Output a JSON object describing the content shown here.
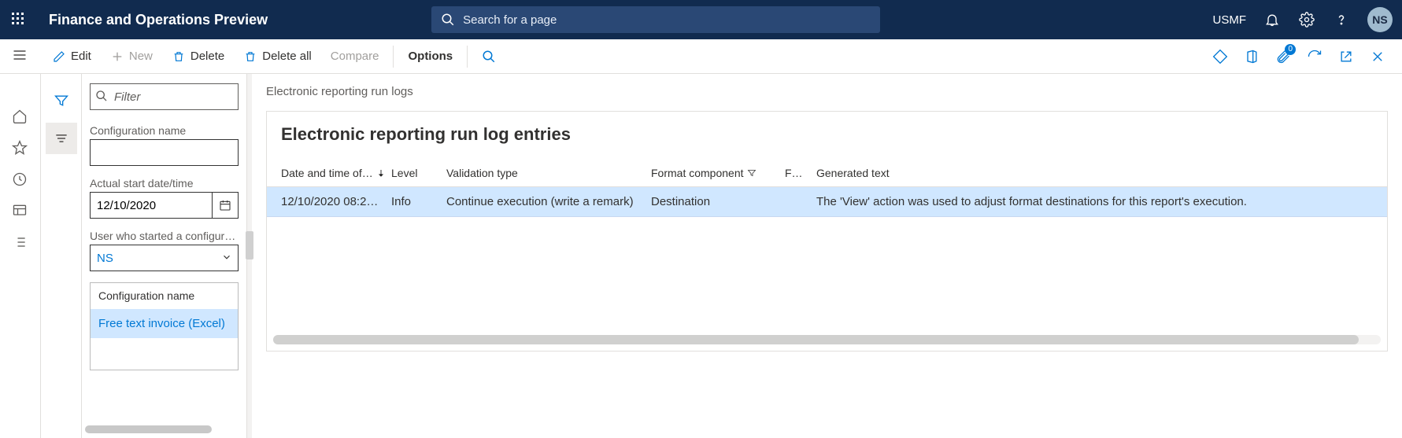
{
  "header": {
    "app_title": "Finance and Operations Preview",
    "search_placeholder": "Search for a page",
    "company": "USMF",
    "user_initials": "NS"
  },
  "toolbar": {
    "edit": "Edit",
    "new": "New",
    "delete": "Delete",
    "delete_all": "Delete all",
    "compare": "Compare",
    "options": "Options",
    "attach_badge": "0"
  },
  "filter": {
    "filter_placeholder": "Filter",
    "config_label": "Configuration name",
    "config_value": "",
    "start_label": "Actual start date/time",
    "start_value": "12/10/2020",
    "user_label": "User who started a configuration",
    "user_value": "NS",
    "list_header": "Configuration name",
    "list_item_0": "Free text invoice (Excel)"
  },
  "main": {
    "breadcrumb": "Electronic reporting run logs",
    "card_title": "Electronic reporting run log entries",
    "columns": {
      "c0": "Date and time of…",
      "c1": "Level",
      "c2": "Validation type",
      "c3": "Format component",
      "c4": "F…",
      "c5": "Generated text"
    },
    "rows": [
      {
        "date": "12/10/2020 08:2…",
        "level": "Info",
        "vtype": "Continue execution (write a remark)",
        "fcomp": "Destination",
        "f": "",
        "gen": "The 'View' action was used to adjust format destinations for this report's execution."
      }
    ]
  }
}
